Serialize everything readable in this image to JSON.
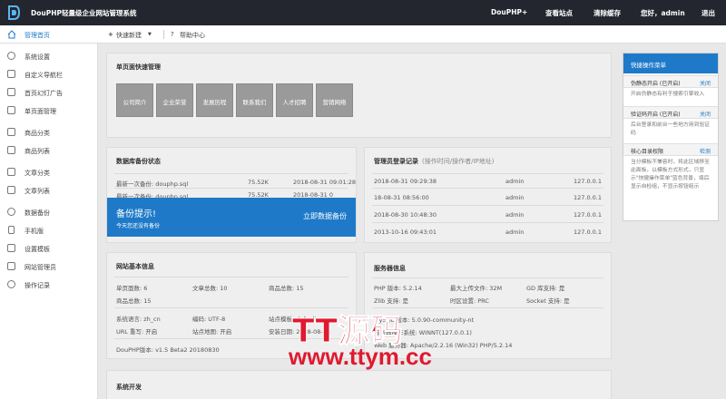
{
  "topbar": {
    "app_title": "DouPHP轻量级企业网站管理系统",
    "links": [
      "DouPHP+",
      "查看站点",
      "清除缓存",
      "您好，admin",
      "退出"
    ]
  },
  "toolbar": {
    "home": "管理首页",
    "quick_new": "快速新建",
    "help": "帮助中心"
  },
  "sidebar": {
    "items": [
      {
        "label": "系统设置",
        "icon": "gear-icon"
      },
      {
        "label": "自定义导航栏",
        "icon": "nav-icon"
      },
      {
        "label": "首页幻灯广告",
        "icon": "image-icon"
      },
      {
        "label": "单页面管理",
        "icon": "page-icon"
      },
      {
        "label": "商品分类",
        "icon": "category-icon"
      },
      {
        "label": "商品列表",
        "icon": "list-icon"
      },
      {
        "label": "文章分类",
        "icon": "folder-icon"
      },
      {
        "label": "文章列表",
        "icon": "document-icon"
      },
      {
        "label": "数据备份",
        "icon": "database-icon"
      },
      {
        "label": "手机版",
        "icon": "mobile-icon"
      },
      {
        "label": "设置模板",
        "icon": "template-icon"
      },
      {
        "label": "网站管理员",
        "icon": "user-icon"
      },
      {
        "label": "操作记录",
        "icon": "clock-icon"
      }
    ]
  },
  "single_page": {
    "title": "单页面快速管理",
    "buttons": [
      "公司简介",
      "企业荣誉",
      "发展历程",
      "联系我们",
      "人才招聘",
      "营销网络"
    ]
  },
  "db_backup": {
    "title": "数据库备份状态",
    "rows": [
      {
        "label": "最新一次备份: douphp.sql",
        "size": "75.52K",
        "time": "2018-08-31 09:01:28"
      },
      {
        "label": "最新一次备份: douphp.sql",
        "size": "75.52K",
        "time": "2018-08-31 0"
      }
    ],
    "reminder_title": "备份提示!",
    "reminder_sub": "今天您还没有备份",
    "reminder_button": "立即数据备份"
  },
  "admin_log": {
    "title": "管理员登录记录",
    "subtitle": "(操作时间/操作者/IP地址)",
    "rows": [
      {
        "time": "2018-08-31 09:29:38",
        "user": "admin",
        "ip": "127.0.0.1"
      },
      {
        "time": "18-08-31 08:56:00",
        "user": "admin",
        "ip": "127.0.0.1"
      },
      {
        "time": "2018-08-30 10:48:30",
        "user": "admin",
        "ip": "127.0.0.1"
      },
      {
        "time": "2013-10-16 09:43:01",
        "user": "admin",
        "ip": "127.0.0.1"
      }
    ]
  },
  "site_info": {
    "title": "网站基本信息",
    "r1": [
      "单页面数: 6",
      "文章总数: 10",
      "商品总数: 15"
    ],
    "r2": [
      "商品总数: 15"
    ],
    "r3": [
      "系统语言: zh_cn",
      "编码: UTF-8",
      "站点模板: default"
    ],
    "r4": [
      "URL 重写: 开启",
      "站点地图: 开启",
      "安装日期: 2018-08-2"
    ],
    "version": "DouPHP版本: v1.5 Beta2 20180830"
  },
  "server_info": {
    "title": "服务器信息",
    "r1": [
      "PHP 版本: 5.2.14",
      "最大上传文件: 32M",
      "GD 库支持: 是"
    ],
    "r2": [
      "Zlib 支持: 是",
      "时区设置: PRC",
      "Socket 支持: 是"
    ],
    "r3": [
      "MySQL 版本: 5.0.90-community-nt"
    ],
    "r4": [
      "服务器操作系统: WINNT(127.0.0.1)"
    ],
    "r5": [
      "Web 服务器: Apache/2.2.16 (Win32) PHP/5.2.14"
    ]
  },
  "system_dev": {
    "title": "系统开发"
  },
  "right_panel": {
    "title": "快捷操作菜单",
    "sections": [
      {
        "title": "伪静态开启 (已开启)",
        "link": "关闭",
        "body": "开启伪静态有利于搜索引擎收入"
      },
      {
        "title": "验证码开启 (已开启)",
        "link": "关闭",
        "body": "后台登录和前台一些地方用到验证码"
      },
      {
        "title": "核心目录权限",
        "link": "检测",
        "body": "当分模板不兼容时，将此区域移至此面板，以模板方式形式，只显示\"快捷操作菜单\"蓝色背景，填后显示自检组，不显示按钮组示"
      }
    ]
  },
  "watermark": {
    "line1": "TT源码",
    "line2": "www.ttym.cc"
  },
  "colors": {
    "topbar": "#23262e",
    "accent": "#1e7ac8",
    "watermark": "#e0192f"
  }
}
